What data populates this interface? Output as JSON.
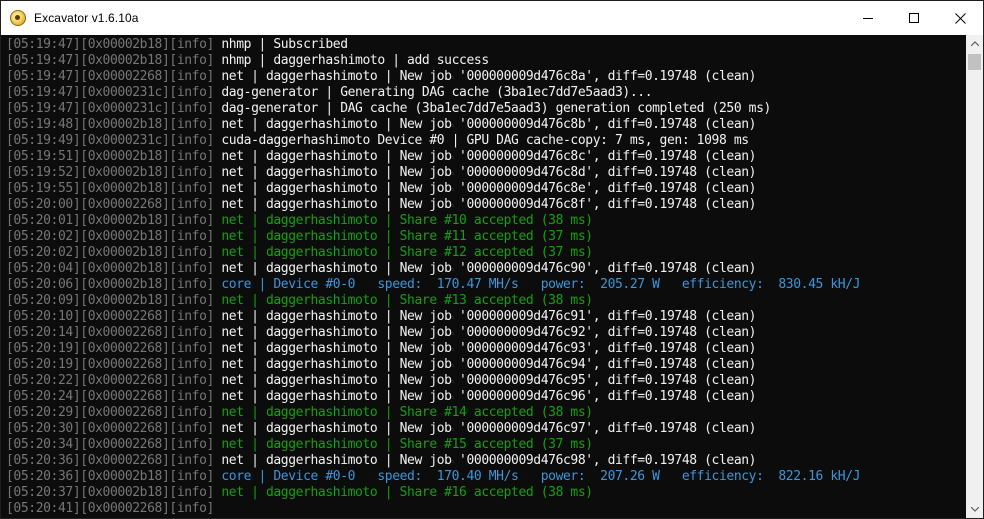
{
  "window": {
    "title": "Excavator v1.6.10a"
  },
  "colors": {
    "prefix": "#767676",
    "normal": "#f2f2f2",
    "share": "#13a10e",
    "core": "#3a96dd",
    "background": "#0c0c0c"
  },
  "log": [
    {
      "prefix": "[05:19:47][0x00002b18][info]",
      "msg": " nhmp | Subscribed",
      "kind": "normal"
    },
    {
      "prefix": "[05:19:47][0x00002b18][info]",
      "msg": " nhmp | daggerhashimoto | add success",
      "kind": "normal"
    },
    {
      "prefix": "[05:19:47][0x00002268][info]",
      "msg": " net | daggerhashimoto | New job '000000009d476c8a', diff=0.19748 (clean)",
      "kind": "normal"
    },
    {
      "prefix": "[05:19:47][0x0000231c][info]",
      "msg": " dag-generator | Generating DAG cache (3ba1ec7dd7e5aad3)...",
      "kind": "normal"
    },
    {
      "prefix": "[05:19:47][0x0000231c][info]",
      "msg": " dag-generator | DAG cache (3ba1ec7dd7e5aad3) generation completed (250 ms)",
      "kind": "normal"
    },
    {
      "prefix": "[05:19:48][0x00002b18][info]",
      "msg": " net | daggerhashimoto | New job '000000009d476c8b', diff=0.19748 (clean)",
      "kind": "normal"
    },
    {
      "prefix": "[05:19:49][0x0000231c][info]",
      "msg": " cuda-daggerhashimoto Device #0 | GPU DAG cache-copy: 7 ms, gen: 1098 ms",
      "kind": "normal"
    },
    {
      "prefix": "[05:19:51][0x00002b18][info]",
      "msg": " net | daggerhashimoto | New job '000000009d476c8c', diff=0.19748 (clean)",
      "kind": "normal"
    },
    {
      "prefix": "[05:19:52][0x00002b18][info]",
      "msg": " net | daggerhashimoto | New job '000000009d476c8d', diff=0.19748 (clean)",
      "kind": "normal"
    },
    {
      "prefix": "[05:19:55][0x00002b18][info]",
      "msg": " net | daggerhashimoto | New job '000000009d476c8e', diff=0.19748 (clean)",
      "kind": "normal"
    },
    {
      "prefix": "[05:20:00][0x00002268][info]",
      "msg": " net | daggerhashimoto | New job '000000009d476c8f', diff=0.19748 (clean)",
      "kind": "normal"
    },
    {
      "prefix": "[05:20:01][0x00002b18][info]",
      "msg": " net | daggerhashimoto | Share #10 accepted (38 ms)",
      "kind": "share"
    },
    {
      "prefix": "[05:20:02][0x00002b18][info]",
      "msg": " net | daggerhashimoto | Share #11 accepted (37 ms)",
      "kind": "share"
    },
    {
      "prefix": "[05:20:02][0x00002b18][info]",
      "msg": " net | daggerhashimoto | Share #12 accepted (37 ms)",
      "kind": "share"
    },
    {
      "prefix": "[05:20:04][0x00002b18][info]",
      "msg": " net | daggerhashimoto | New job '000000009d476c90', diff=0.19748 (clean)",
      "kind": "normal"
    },
    {
      "prefix": "[05:20:06][0x00002b18][info]",
      "msg": " core | Device #0-0   speed:  170.47 MH/s   power:  205.27 W   efficiency:  830.45 kH/J",
      "kind": "core"
    },
    {
      "prefix": "[05:20:09][0x00002b18][info]",
      "msg": " net | daggerhashimoto | Share #13 accepted (38 ms)",
      "kind": "share"
    },
    {
      "prefix": "[05:20:10][0x00002268][info]",
      "msg": " net | daggerhashimoto | New job '000000009d476c91', diff=0.19748 (clean)",
      "kind": "normal"
    },
    {
      "prefix": "[05:20:14][0x00002268][info]",
      "msg": " net | daggerhashimoto | New job '000000009d476c92', diff=0.19748 (clean)",
      "kind": "normal"
    },
    {
      "prefix": "[05:20:19][0x00002268][info]",
      "msg": " net | daggerhashimoto | New job '000000009d476c93', diff=0.19748 (clean)",
      "kind": "normal"
    },
    {
      "prefix": "[05:20:19][0x00002268][info]",
      "msg": " net | daggerhashimoto | New job '000000009d476c94', diff=0.19748 (clean)",
      "kind": "normal"
    },
    {
      "prefix": "[05:20:22][0x00002268][info]",
      "msg": " net | daggerhashimoto | New job '000000009d476c95', diff=0.19748 (clean)",
      "kind": "normal"
    },
    {
      "prefix": "[05:20:24][0x00002268][info]",
      "msg": " net | daggerhashimoto | New job '000000009d476c96', diff=0.19748 (clean)",
      "kind": "normal"
    },
    {
      "prefix": "[05:20:29][0x00002268][info]",
      "msg": " net | daggerhashimoto | Share #14 accepted (38 ms)",
      "kind": "share"
    },
    {
      "prefix": "[05:20:30][0x00002268][info]",
      "msg": " net | daggerhashimoto | New job '000000009d476c97', diff=0.19748 (clean)",
      "kind": "normal"
    },
    {
      "prefix": "[05:20:34][0x00002268][info]",
      "msg": " net | daggerhashimoto | Share #15 accepted (37 ms)",
      "kind": "share"
    },
    {
      "prefix": "[05:20:36][0x00002268][info]",
      "msg": " net | daggerhashimoto | New job '000000009d476c98', diff=0.19748 (clean)",
      "kind": "normal"
    },
    {
      "prefix": "[05:20:36][0x00002b18][info]",
      "msg": " core | Device #0-0   speed:  170.40 MH/s   power:  207.26 W   efficiency:  822.16 kH/J",
      "kind": "core"
    },
    {
      "prefix": "[05:20:37][0x00002b18][info]",
      "msg": " net | daggerhashimoto | Share #16 accepted (38 ms)",
      "kind": "share"
    },
    {
      "prefix": "[05:20:41][0x00002268][info]",
      "msg": "",
      "kind": "normal"
    }
  ]
}
